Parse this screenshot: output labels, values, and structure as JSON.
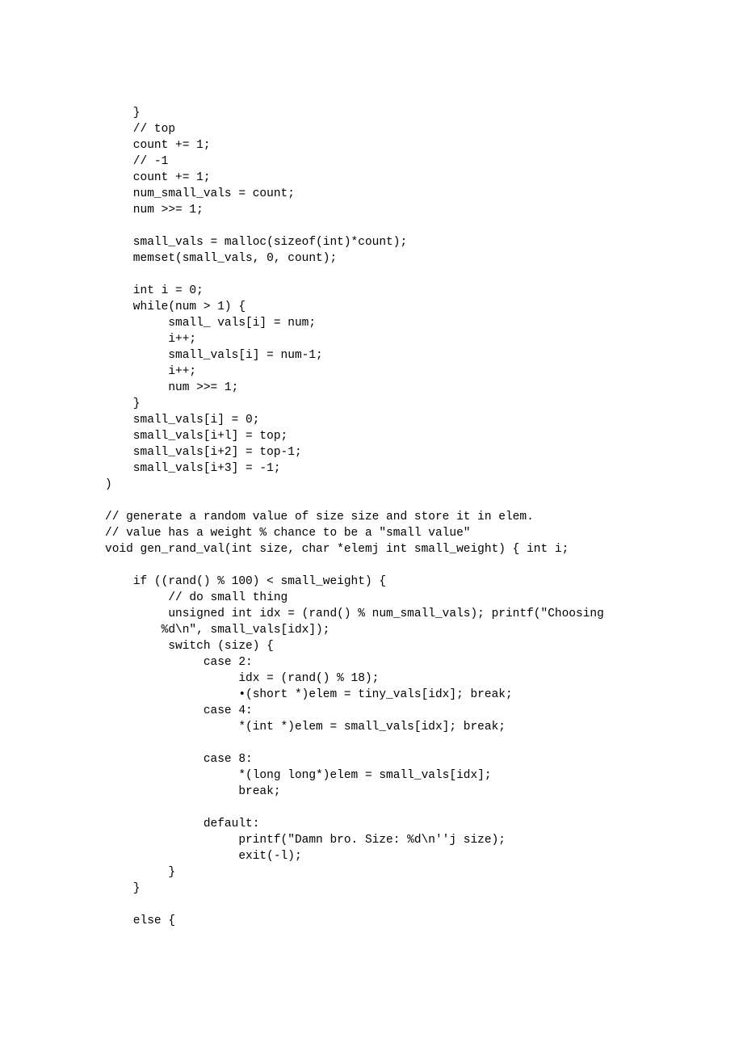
{
  "code": {
    "lines": [
      "    }",
      "    // top",
      "    count += 1;",
      "    // -1",
      "    count += 1;",
      "    num_small_vals = count;",
      "    num >>= 1;",
      "",
      "    small_vals = malloc(sizeof(int)*count);",
      "    memset(small_vals, 0, count);",
      "",
      "    int i = 0;",
      "    while(num > 1) {",
      "         small_ vals[i] = num;",
      "         i++;",
      "         small_vals[i] = num-1;",
      "         i++;",
      "         num >>= 1;",
      "    }",
      "    small_vals[i] = 0;",
      "    small_vals[i+l] = top;",
      "    small_vals[i+2] = top-1;",
      "    small_vals[i+3] = -1;",
      ")",
      "",
      "// generate a random value of size size and store it in elem.",
      "// value has a weight % chance to be a \"small value\"",
      "void gen_rand_val(int size, char *elemj int small_weight) { int i;",
      "",
      "    if ((rand() % 100) < small_weight) {",
      "         // do small thing",
      "         unsigned int idx = (rand() % num_small_vals); printf(\"Choosing",
      "        %d\\n\", small_vals[idx]);",
      "         switch (size) {",
      "              case 2:",
      "                   idx = (rand() % 18);",
      "                   •(short *)elem = tiny_vals[idx]; break;",
      "              case 4:",
      "                   *(int *)elem = small_vals[idx]; break;",
      "",
      "              case 8:",
      "                   *(long long*)elem = small_vals[idx];",
      "                   break;",
      "",
      "              default:",
      "                   printf(\"Damn bro. Size: %d\\n''j size);",
      "                   exit(-l);",
      "         }",
      "    }",
      "",
      "    else {"
    ]
  }
}
